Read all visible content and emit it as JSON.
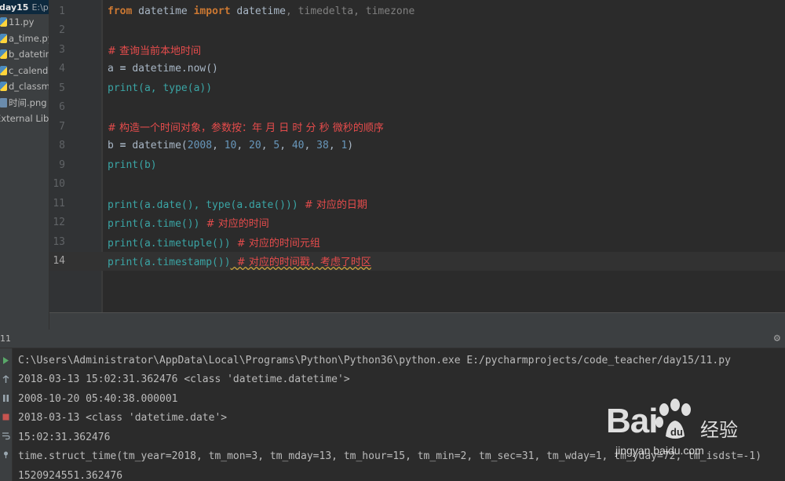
{
  "sidebar": {
    "root_name": "day15",
    "root_path": "E:\\py",
    "items": [
      {
        "label": "11.py",
        "icon": "python-file-icon"
      },
      {
        "label": "a_time.py",
        "icon": "python-file-icon"
      },
      {
        "label": "b_datetime",
        "icon": "python-file-icon"
      },
      {
        "label": "c_calendar",
        "icon": "python-file-icon"
      },
      {
        "label": "d_classm",
        "icon": "python-file-icon"
      },
      {
        "label": "时间.png",
        "icon": "image-file-icon"
      },
      {
        "label": "External Libr",
        "icon": "library-icon"
      }
    ]
  },
  "editor": {
    "current_line": 14,
    "lines": [
      {
        "n": "1"
      },
      {
        "n": "2"
      },
      {
        "n": "3"
      },
      {
        "n": "4"
      },
      {
        "n": "5"
      },
      {
        "n": "6"
      },
      {
        "n": "7"
      },
      {
        "n": "8"
      },
      {
        "n": "9"
      },
      {
        "n": "10"
      },
      {
        "n": "11"
      },
      {
        "n": "12"
      },
      {
        "n": "13"
      },
      {
        "n": "14"
      }
    ],
    "code": {
      "l1": [
        "from",
        " datetime ",
        "import",
        " datetime",
        ", timedelta, timezone"
      ],
      "l3": "# 查询当前本地时间",
      "l4": [
        "a",
        " = ",
        "datetime.now()"
      ],
      "l5": [
        "print",
        "(a, ",
        "type",
        "(a))"
      ],
      "l7": "# 构造一个时间对象，参数按：年 月 日 时 分 秒 微秒的顺序",
      "l8": [
        "b",
        " = ",
        "datetime(",
        "2008",
        ", ",
        "10",
        ", ",
        "20",
        ", ",
        "5",
        ", ",
        "40",
        ", ",
        "38",
        ", ",
        "1",
        ")"
      ],
      "l9": [
        "print",
        "(b)"
      ],
      "l11": [
        "print",
        "(a.date(), ",
        "type",
        "(a.date()))",
        "  # 对应的日期"
      ],
      "l12": [
        "print",
        "(a.time())",
        "  # 对应的时间"
      ],
      "l13": [
        "print",
        "(a.timetuple())",
        "  # 对应的时间元组"
      ],
      "l14": [
        "print",
        "(a.timestamp())",
        "  # 对应的时间戳，考虑了时区"
      ]
    }
  },
  "run": {
    "title": "11",
    "settings_icon": "gear-icon",
    "output": [
      "C:\\Users\\Administrator\\AppData\\Local\\Programs\\Python\\Python36\\python.exe E:/pycharmprojects/code_teacher/day15/11.py",
      "2018-03-13 15:02:31.362476 <class 'datetime.datetime'>",
      "2008-10-20 05:40:38.000001",
      "2018-03-13 <class 'datetime.date'>",
      "15:02:31.362476",
      "time.struct_time(tm_year=2018, tm_mon=3, tm_mday=13, tm_hour=15, tm_min=2, tm_sec=31, tm_wday=1, tm_yday=72, tm_isdst=-1)",
      "1520924551.362476"
    ]
  },
  "watermark": {
    "logo": "Bai",
    "logo_du": "du",
    "text": "经验",
    "url": "jingyan.baidu.com"
  }
}
